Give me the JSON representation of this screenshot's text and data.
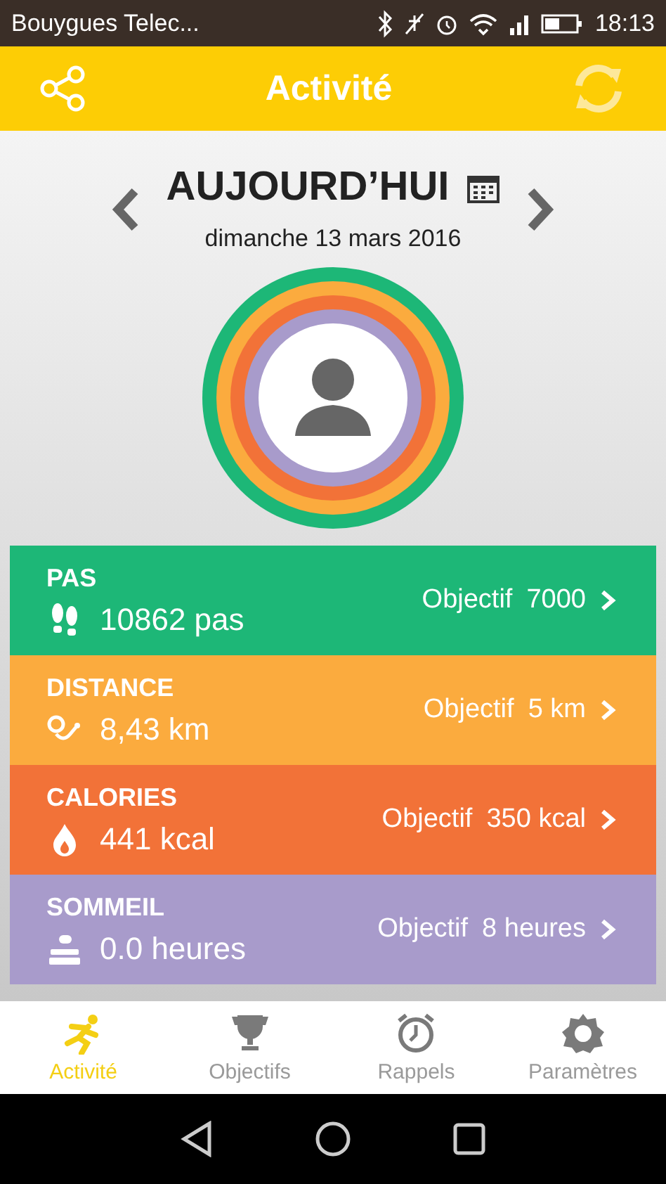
{
  "status_bar": {
    "carrier": "Bouygues Telec...",
    "time": "18:13"
  },
  "header": {
    "title": "Activité"
  },
  "date_nav": {
    "title": "AUJOURD’HUI",
    "date": "dimanche 13 mars 2016"
  },
  "metrics": [
    {
      "kind": "steps",
      "label": "PAS",
      "value": "10862 pas",
      "goal_label": "Objectif",
      "goal": "7000",
      "color": "#1db777"
    },
    {
      "kind": "distance",
      "label": "DISTANCE",
      "value": "8,43 km",
      "goal_label": "Objectif",
      "goal": "5 km",
      "color": "#fbab3e"
    },
    {
      "kind": "calories",
      "label": "CALORIES",
      "value": "441 kcal",
      "goal_label": "Objectif",
      "goal": "350 kcal",
      "color": "#f27238"
    },
    {
      "kind": "sleep",
      "label": "SOMMEIL",
      "value": "0.0 heures",
      "goal_label": "Objectif",
      "goal": "8 heures",
      "color": "#a89bcb"
    }
  ],
  "bottom_nav": [
    {
      "kind": "activity",
      "label": "Activité",
      "selected": true
    },
    {
      "kind": "goals",
      "label": "Objectifs",
      "selected": false
    },
    {
      "kind": "reminders",
      "label": "Rappels",
      "selected": false
    },
    {
      "kind": "settings",
      "label": "Paramètres",
      "selected": false
    }
  ]
}
